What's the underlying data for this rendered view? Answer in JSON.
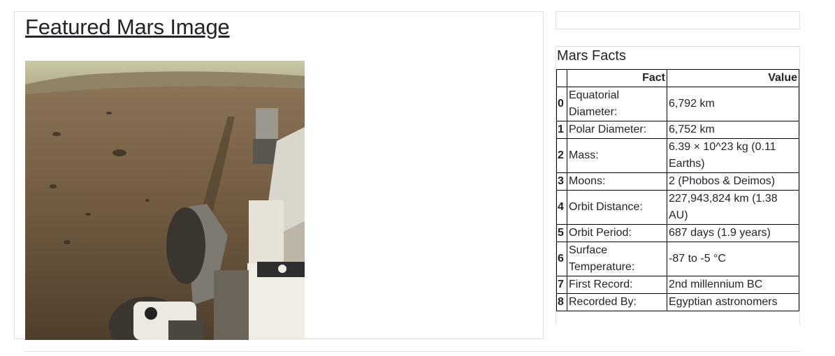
{
  "featured": {
    "title": "Featured Mars Image",
    "image_alt": "Mars surface seen from rover"
  },
  "facts": {
    "title": "Mars Facts",
    "header": {
      "index": "",
      "fact": "Fact",
      "value": "Value"
    },
    "rows": [
      {
        "index": "0",
        "fact": "Equatorial Diameter:",
        "value": "6,792 km"
      },
      {
        "index": "1",
        "fact": "Polar Diameter:",
        "value": "6,752 km"
      },
      {
        "index": "2",
        "fact": "Mass:",
        "value": "6.39 × 10^23 kg (0.11 Earths)"
      },
      {
        "index": "3",
        "fact": "Moons:",
        "value": "2 (Phobos & Deimos)"
      },
      {
        "index": "4",
        "fact": "Orbit Distance:",
        "value": "227,943,824 km (1.38 AU)"
      },
      {
        "index": "5",
        "fact": "Orbit Period:",
        "value": "687 days (1.9 years)"
      },
      {
        "index": "6",
        "fact": "Surface Temperature:",
        "value": "-87 to -5 °C"
      },
      {
        "index": "7",
        "fact": "First Record:",
        "value": "2nd millennium BC"
      },
      {
        "index": "8",
        "fact": "Recorded By:",
        "value": "Egyptian astronomers"
      }
    ]
  },
  "colors": {
    "border": "#dee2e6",
    "text": "#212529"
  }
}
